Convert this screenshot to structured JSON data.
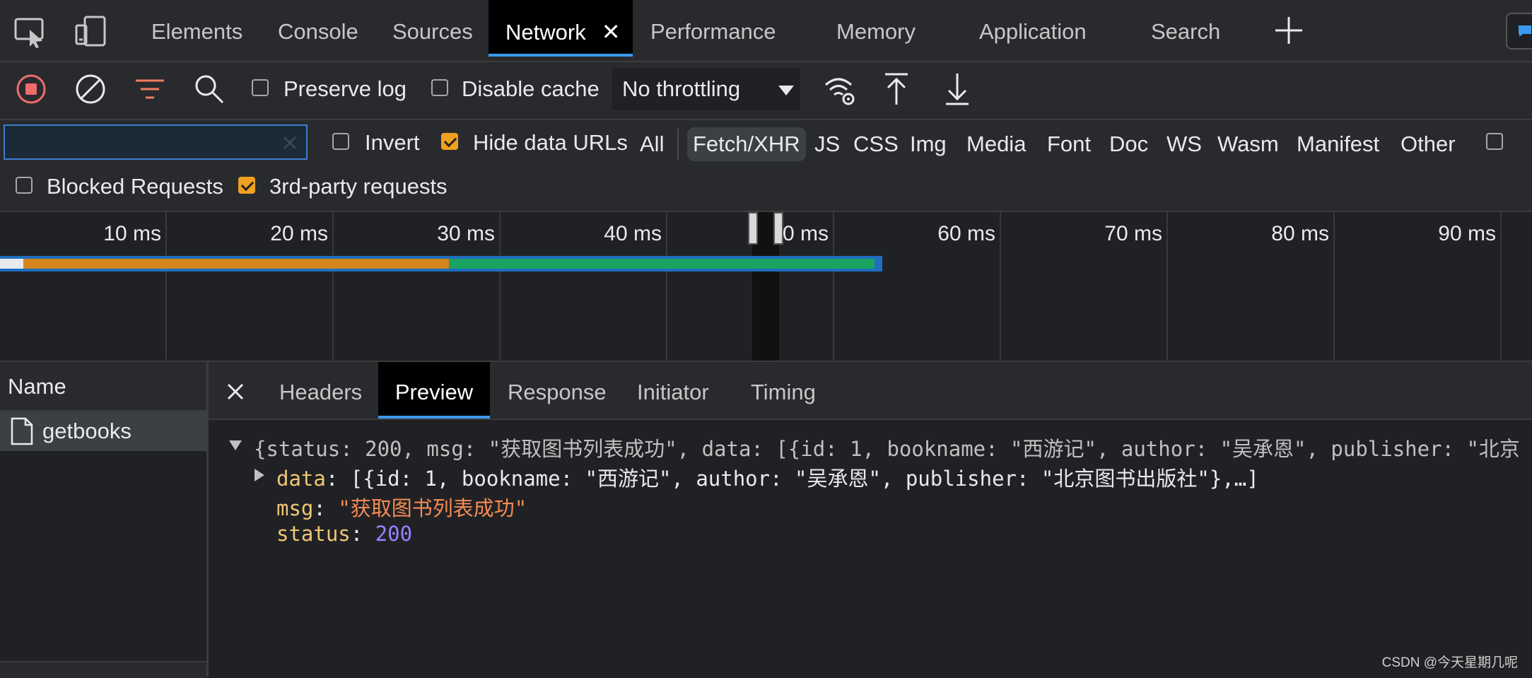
{
  "top_tabs": [
    {
      "label": "Elements"
    },
    {
      "label": "Console"
    },
    {
      "label": "Sources"
    },
    {
      "label": "Network",
      "active": true
    },
    {
      "label": "Performance"
    },
    {
      "label": "Memory"
    },
    {
      "label": "Application"
    },
    {
      "label": "Search"
    }
  ],
  "toolbar": {
    "preserve_log": "Preserve log",
    "disable_cache": "Disable cache",
    "throttling": "No throttling"
  },
  "filter": {
    "placeholder": "",
    "invert": "Invert",
    "hide_data_urls": "Hide data URLs",
    "types": [
      "All",
      "Fetch/XHR",
      "JS",
      "CSS",
      "Img",
      "Media",
      "Font",
      "Doc",
      "WS",
      "Wasm",
      "Manifest",
      "Other"
    ],
    "active_type": "Fetch/XHR",
    "blocked_requests": "Blocked Requests",
    "third_party": "3rd-party requests"
  },
  "timeline": {
    "ticks": [
      "10 ms",
      "20 ms",
      "30 ms",
      "40 ms",
      "50 ms",
      "60 ms",
      "70 ms",
      "80 ms",
      "90 ms"
    ],
    "waterfall": {
      "start_ms": 0,
      "waiting_end_ms": 27,
      "download_end_ms": 52.5
    }
  },
  "requests": {
    "header": "Name",
    "items": [
      {
        "name": "getbooks"
      }
    ]
  },
  "detail_tabs": [
    {
      "label": "Headers"
    },
    {
      "label": "Preview",
      "active": true
    },
    {
      "label": "Response"
    },
    {
      "label": "Initiator"
    },
    {
      "label": "Timing"
    }
  ],
  "preview": {
    "summary": "{status: 200, msg: \"获取图书列表成功\", data: [{id: 1, bookname: \"西游记\", author: \"吴承恩\", publisher: \"北京",
    "data_key": "data",
    "data_value": "[{id: 1, bookname: \"西游记\", author: \"吴承恩\", publisher: \"北京图书出版社\"},…]",
    "msg_key": "msg",
    "msg_value": "\"获取图书列表成功\"",
    "status_key": "status",
    "status_value": "200"
  },
  "watermark": "CSDN @今天星期几呢",
  "colors": {
    "accent": "#3b9af0",
    "waiting": "#d4861c",
    "download": "#1aa260",
    "checkbox_on": "#f0a020"
  }
}
